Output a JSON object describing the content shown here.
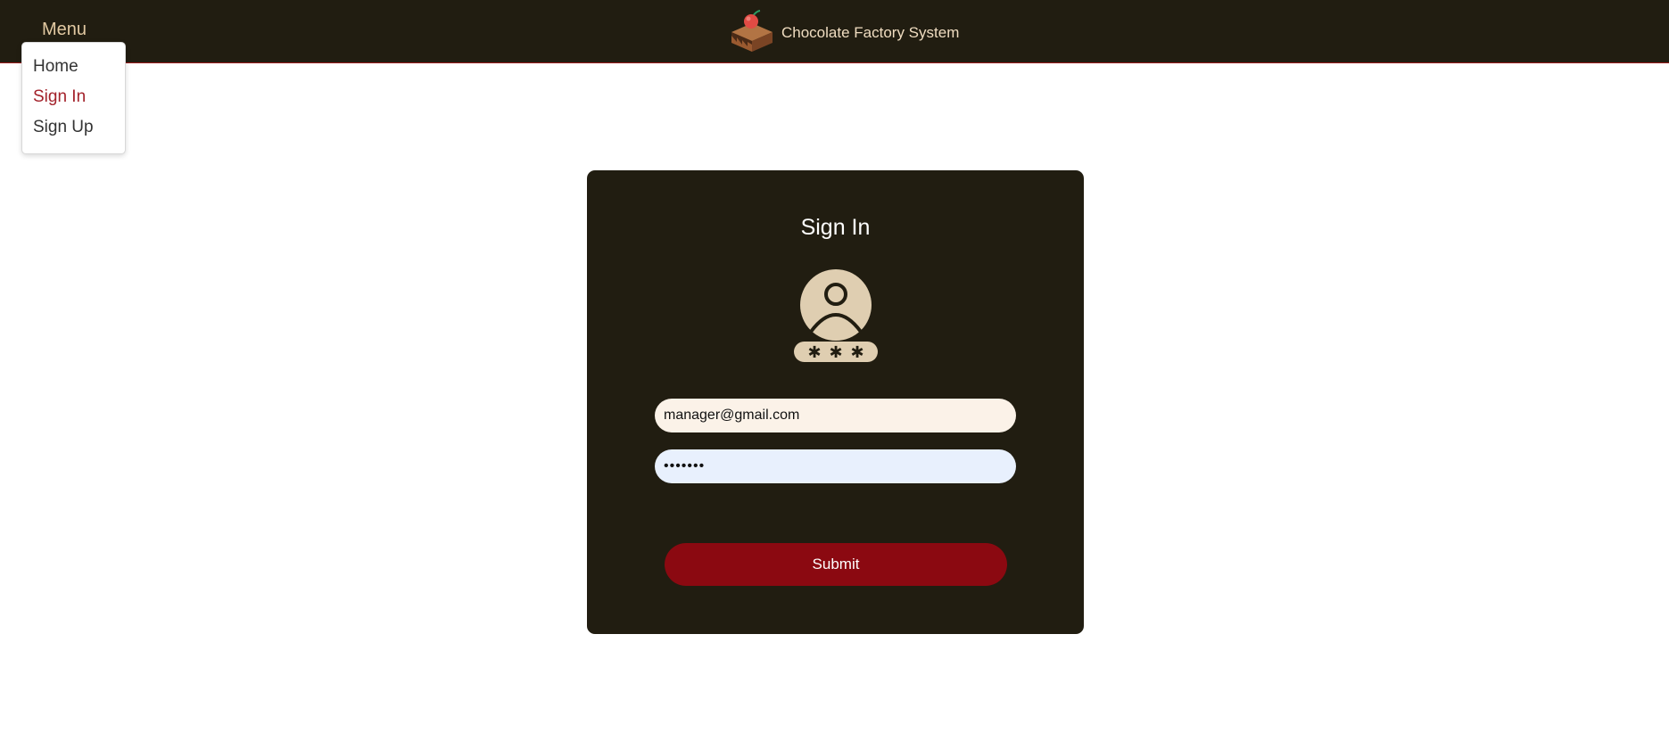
{
  "header": {
    "menu_label": "Menu",
    "brand_title": "Chocolate Factory System",
    "logo_icon": "chocolate-cake-icon"
  },
  "menu": {
    "items": [
      {
        "label": "Home",
        "active": false
      },
      {
        "label": "Sign In",
        "active": true
      },
      {
        "label": "Sign Up",
        "active": false
      }
    ]
  },
  "signin": {
    "title": "Sign In",
    "avatar_icon": "user-password-icon",
    "email_value": "manager@gmail.com",
    "password_value": "•••••••",
    "submit_label": "Submit"
  },
  "colors": {
    "header_bg": "#211d11",
    "card_bg": "#211d11",
    "accent": "#8b0911",
    "menu_label": "#e2c9a2",
    "active_menu": "#a3222b"
  }
}
